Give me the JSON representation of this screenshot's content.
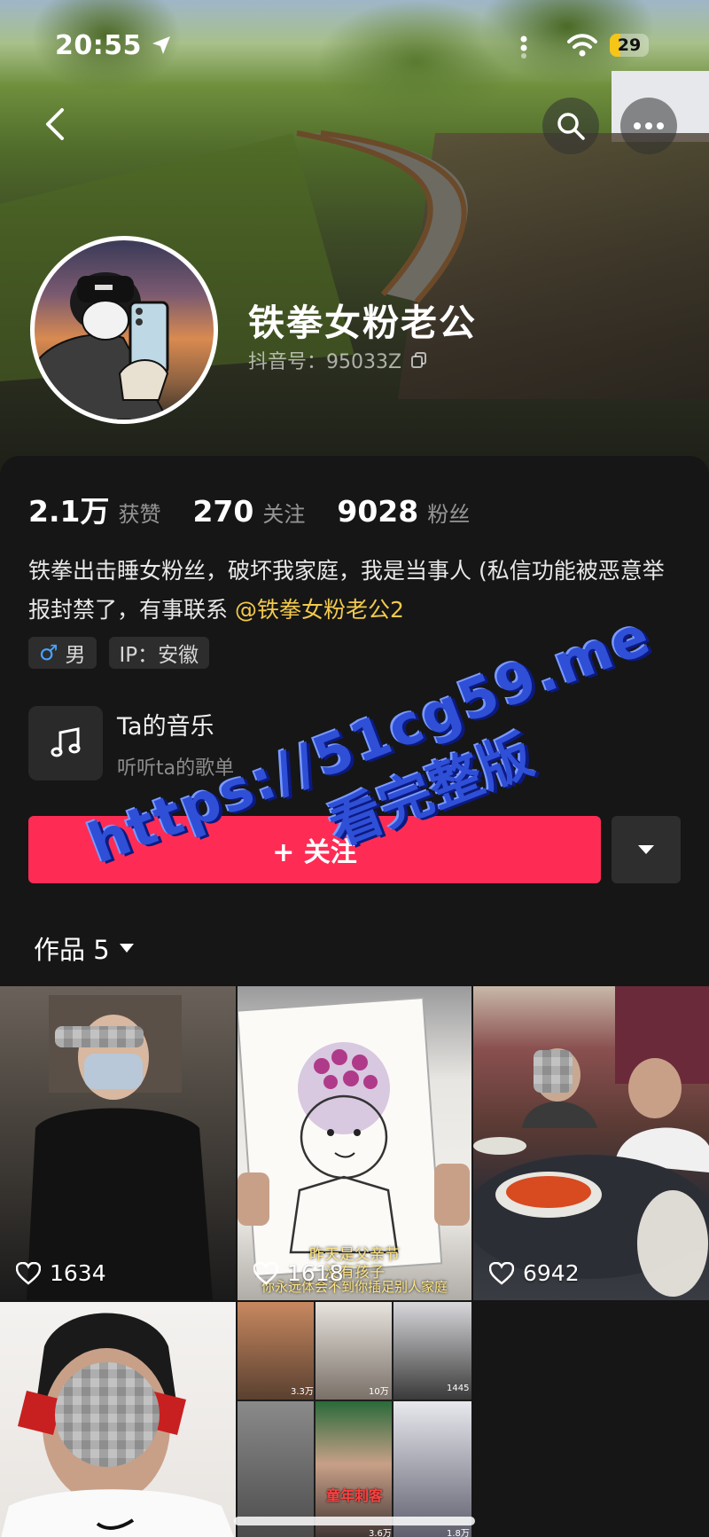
{
  "status_bar": {
    "time": "20:55",
    "battery": "29"
  },
  "profile": {
    "nickname": "铁拳女粉老公",
    "douyin_id": "抖音号：95033Z",
    "stats": [
      {
        "value": "2.1万",
        "label": "获赞"
      },
      {
        "value": "270",
        "label": "关注"
      },
      {
        "value": "9028",
        "label": "粉丝"
      }
    ],
    "bio_text": "铁拳出击睡女粉丝，破坏我家庭，我是当事人 (私信功能被恶意举报封禁了，有事联系 ",
    "bio_mention": "@铁拳女粉老公2",
    "tags": {
      "gender": "男",
      "ip": "IP：安徽"
    }
  },
  "music": {
    "title": "Ta的音乐",
    "subtitle": "听听ta的歌单"
  },
  "follow": {
    "label": "+ 关注"
  },
  "works_tab": {
    "label": "作品 5"
  },
  "videos": [
    {
      "likes": "1634"
    },
    {
      "likes": "1618",
      "caption_1": "昨天是父亲节",
      "caption_2": "没有孩子",
      "caption_3": "你永远体会不到你插足别人家庭"
    },
    {
      "likes": "6942"
    },
    {
      "likes": ""
    },
    {
      "likes": "",
      "collage_label_1": "3.3万",
      "collage_label_2": "10万",
      "collage_label_3": "1445",
      "collage_label_4": "童年刺客",
      "collage_label_5": "3.6万",
      "collage_label_6": "1.8万"
    }
  ],
  "watermark": {
    "line1": "https://51cg59.me",
    "line2": "看完整版"
  },
  "colors": {
    "accent": "#fe2c55",
    "mention": "#f2c94c",
    "panel": "#161616",
    "watermark": "#2e4fd6"
  }
}
